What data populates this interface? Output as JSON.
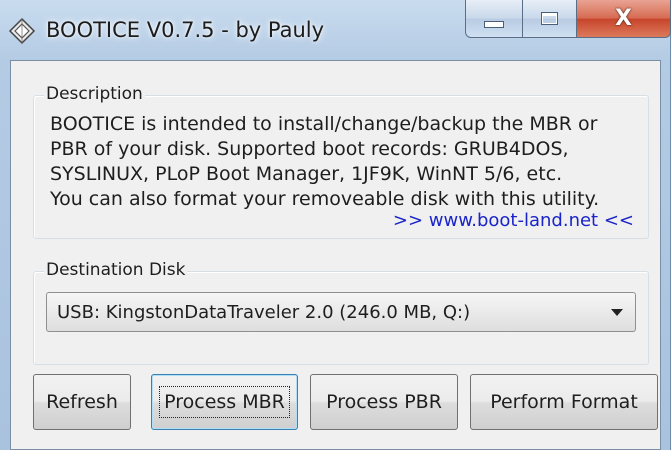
{
  "window": {
    "title": "BOOTICE V0.7.5 - by Pauly",
    "controls": {
      "minimize": "minimize",
      "maximize": "maximize",
      "close": "X"
    }
  },
  "description": {
    "group_label": "Description",
    "text": "BOOTICE is intended to install/change/backup the MBR or\nPBR of your disk. Supported boot records: GRUB4DOS,\nSYSLINUX, PLoP Boot Manager, 1JF9K, WinNT 5/6, etc.\nYou can also format your removeable disk with this utility.",
    "link": ">> www.boot-land.net <<"
  },
  "destination": {
    "group_label": "Destination Disk",
    "selected": "USB: KingstonDataTraveler 2.0 (246.0 MB, Q:)"
  },
  "buttons": {
    "refresh": "Refresh",
    "process_mbr": "Process MBR",
    "process_pbr": "Process PBR",
    "perform_format": "Perform Format"
  },
  "icons": {
    "app": "diamond-app-icon",
    "minimize": "minimize-icon",
    "maximize": "maximize-icon",
    "close": "close-icon",
    "dropdown": "chevron-down-icon"
  },
  "colors": {
    "link": "#1a24c8",
    "close_button": "#c7442a",
    "focus_border": "#3c7fb1"
  }
}
